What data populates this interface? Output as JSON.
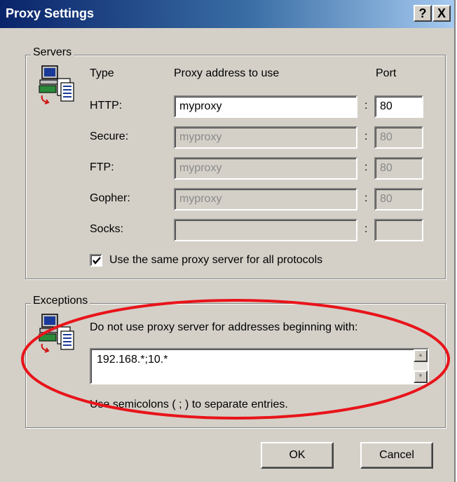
{
  "window": {
    "title": "Proxy Settings",
    "help_label": "?",
    "close_label": "X"
  },
  "servers": {
    "legend": "Servers",
    "header_type": "Type",
    "header_address": "Proxy address to use",
    "header_port": "Port",
    "rows": [
      {
        "label": "HTTP:",
        "address": "myproxy",
        "port": "80",
        "enabled": true
      },
      {
        "label": "Secure:",
        "address": "myproxy",
        "port": "80",
        "enabled": false
      },
      {
        "label": "FTP:",
        "address": "myproxy",
        "port": "80",
        "enabled": false
      },
      {
        "label": "Gopher:",
        "address": "myproxy",
        "port": "80",
        "enabled": false
      },
      {
        "label": "Socks:",
        "address": "",
        "port": "",
        "enabled": false
      }
    ],
    "same_proxy_label": "Use the same proxy server for all protocols",
    "same_proxy_checked": true,
    "icon": "computer-documents-icon"
  },
  "exceptions": {
    "legend": "Exceptions",
    "description": "Do not use proxy server for addresses beginning with:",
    "value": "192.168.*;10.*",
    "hint": "Use semicolons ( ; ) to separate entries.",
    "icon": "computer-documents-icon"
  },
  "buttons": {
    "ok": "OK",
    "cancel": "Cancel"
  },
  "colors": {
    "title_start": "#0a246a",
    "title_end": "#a6caf0",
    "face": "#d4d0c8",
    "annotation": "#e8141a"
  }
}
